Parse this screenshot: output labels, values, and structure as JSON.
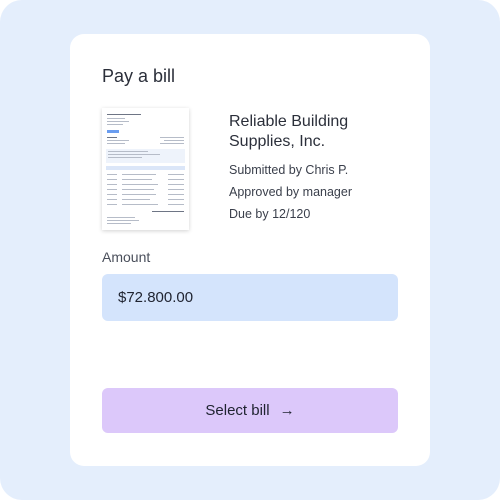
{
  "dialog": {
    "title": "Pay a bill"
  },
  "bill": {
    "vendor": "Reliable Building Supplies, Inc.",
    "submitted": "Submitted by Chris P.",
    "approved": "Approved by manager",
    "due": "Due by 12/120"
  },
  "amount": {
    "label": "Amount",
    "value": "$72.800.00"
  },
  "actions": {
    "select_label": "Select bill",
    "arrow_icon": "arrow-right-icon"
  }
}
